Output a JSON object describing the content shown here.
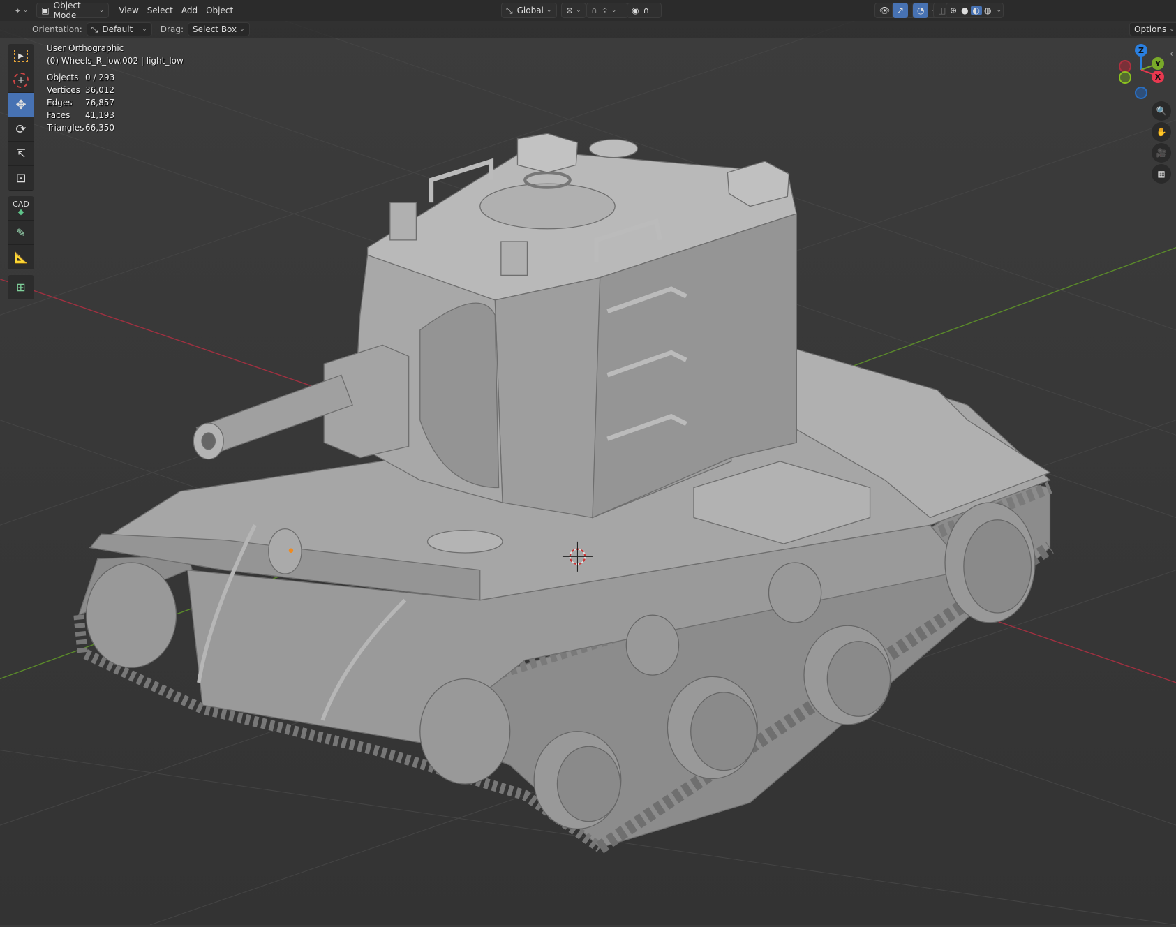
{
  "header": {
    "mode": "Object Mode",
    "menus": [
      "View",
      "Select",
      "Add",
      "Object"
    ],
    "transform_orientation": "Global"
  },
  "tool_settings": {
    "orientation_label": "Orientation:",
    "orientation_value": "Default",
    "drag_label": "Drag:",
    "drag_value": "Select Box",
    "options_label": "Options"
  },
  "overlay": {
    "view_name": "User Orthographic",
    "active_object": "(0) Wheels_R_low.002 | light_low",
    "stats": [
      {
        "label": "Objects",
        "value": "0 / 293"
      },
      {
        "label": "Vertices",
        "value": "36,012"
      },
      {
        "label": "Edges",
        "value": "76,857"
      },
      {
        "label": "Faces",
        "value": "41,193"
      },
      {
        "label": "Triangles",
        "value": "66,350"
      }
    ]
  },
  "toolbar": {
    "tools": [
      "select-box",
      "cursor",
      "move",
      "rotate",
      "scale",
      "transform",
      "cad-transform",
      "annotate",
      "measure",
      "add-cube"
    ],
    "active": "move",
    "cad_label": "CAD"
  },
  "gizmo": {
    "x": "X",
    "y": "Y",
    "z": "Z",
    "colors": {
      "x": "#e8384f",
      "y": "#79a929",
      "z": "#2a7fe0"
    }
  },
  "colors": {
    "accent": "#4772b3",
    "background": "#3a3a3a",
    "header": "#2b2b2b"
  }
}
